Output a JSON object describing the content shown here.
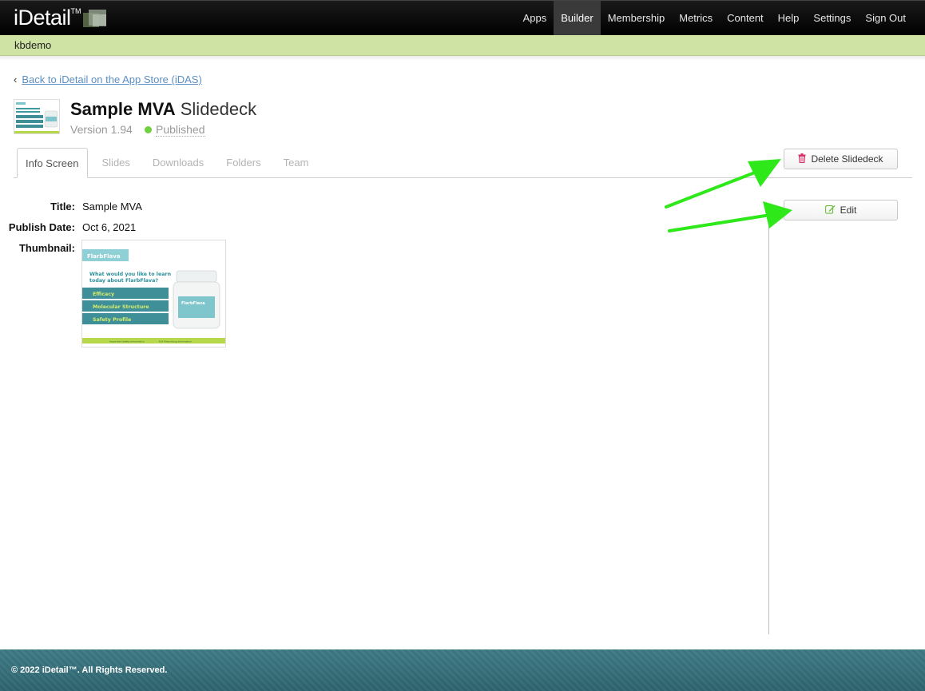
{
  "brand": {
    "name": "iDetail",
    "tm": "TM"
  },
  "nav": {
    "items": [
      {
        "label": "Apps"
      },
      {
        "label": "Builder"
      },
      {
        "label": "Membership"
      },
      {
        "label": "Metrics"
      },
      {
        "label": "Content"
      },
      {
        "label": "Help"
      },
      {
        "label": "Settings"
      },
      {
        "label": "Sign Out"
      }
    ],
    "active": "Builder"
  },
  "account": {
    "name": "kbdemo"
  },
  "back_link": {
    "text": "Back to iDetail on the App Store (iDAS)"
  },
  "deck": {
    "name_bold": "Sample MVA",
    "name_type": "Slidedeck",
    "version": "Version 1.94",
    "status": "Published",
    "status_color": "#6fd13d"
  },
  "tabs": [
    {
      "label": "Info Screen"
    },
    {
      "label": "Slides"
    },
    {
      "label": "Downloads"
    },
    {
      "label": "Folders"
    },
    {
      "label": "Team"
    }
  ],
  "actions": {
    "delete_label": "Delete Slidedeck",
    "delete_icon": "trash-icon",
    "edit_label": "Edit",
    "edit_icon": "edit-icon"
  },
  "details": {
    "title_label": "Title:",
    "title_value": "Sample MVA",
    "publish_label": "Publish Date:",
    "publish_value": "Oct 6, 2021",
    "thumbnail_label": "Thumbnail:"
  },
  "thumbnail": {
    "brand": "FlarbFlava",
    "question": "What would you like to learn today about FlarbFlava?",
    "menu": [
      "Efficacy",
      "Molecular Structure",
      "Safety Profile"
    ],
    "bottle_label": "FlarbFlava",
    "footer_links": [
      "Important Safety Information",
      "Full Prescribing Information"
    ]
  },
  "footer": {
    "text": "© 2022 iDetail™.  All Rights Reserved."
  },
  "colors": {
    "accent_green": "#cfe3a4",
    "link_blue": "#5b8fc2",
    "annotation_arrow": "#2ee81a",
    "footer_teal": "#3f7b86"
  }
}
